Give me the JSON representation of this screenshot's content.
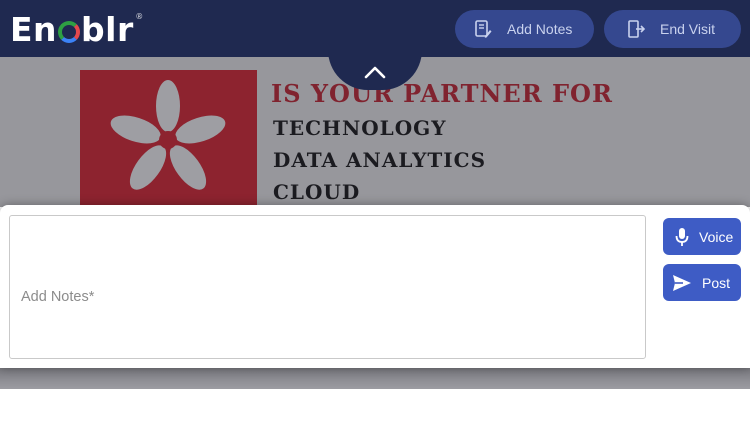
{
  "header": {
    "logo_text": "Enoblr",
    "logo_reg": "®",
    "add_notes_label": "Add Notes",
    "end_visit_label": "End Visit",
    "add_notes_icon": "notes-edit-icon",
    "end_visit_icon": "exit-door-icon",
    "colors": {
      "bar": "#1f2950",
      "button": "#35488f"
    }
  },
  "slide": {
    "headline": "IS YOUR PARTNER FOR",
    "lines": [
      "TECHNOLOGY",
      "DATA ANALYTICS",
      "CLOUD"
    ],
    "colors": {
      "accent": "#e01f2c"
    }
  },
  "collapse_toggle": {
    "icon": "chevron-up-icon"
  },
  "notes_panel": {
    "textarea_value": "",
    "placeholder": "Add Notes*",
    "voice_label": "Voice",
    "post_label": "Post",
    "voice_icon": "microphone-icon",
    "post_icon": "send-icon",
    "colors": {
      "action_button": "#3e5cc5"
    }
  }
}
